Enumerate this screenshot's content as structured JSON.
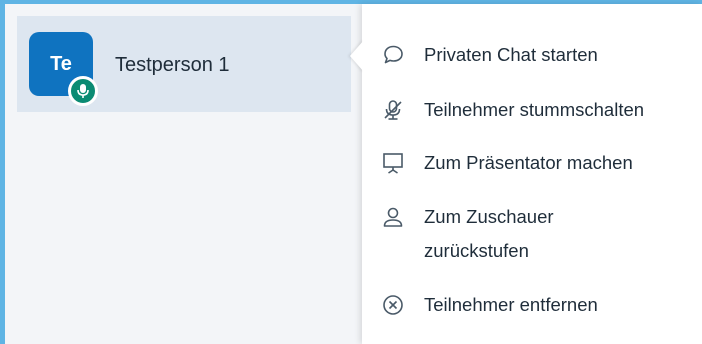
{
  "user": {
    "initials": "Te",
    "name": "Testperson 1"
  },
  "menu": {
    "items": [
      {
        "label": "Privaten Chat starten",
        "icon": "chat-bubble-icon"
      },
      {
        "label": "Teilnehmer stummschalten",
        "icon": "mic-muted-icon"
      },
      {
        "label": "Zum Präsentator machen",
        "icon": "presentation-screen-icon"
      },
      {
        "label": "Zum Zuschauer zurückstufen",
        "icon": "person-icon"
      },
      {
        "label": "Teilnehmer entfernen",
        "icon": "close-circle-icon"
      }
    ]
  },
  "colors": {
    "avatar": "#0f73c0",
    "mic_badge": "#0b8b73",
    "selected_row": "#dde6f0",
    "frame_accent": "#5fb4e4"
  }
}
